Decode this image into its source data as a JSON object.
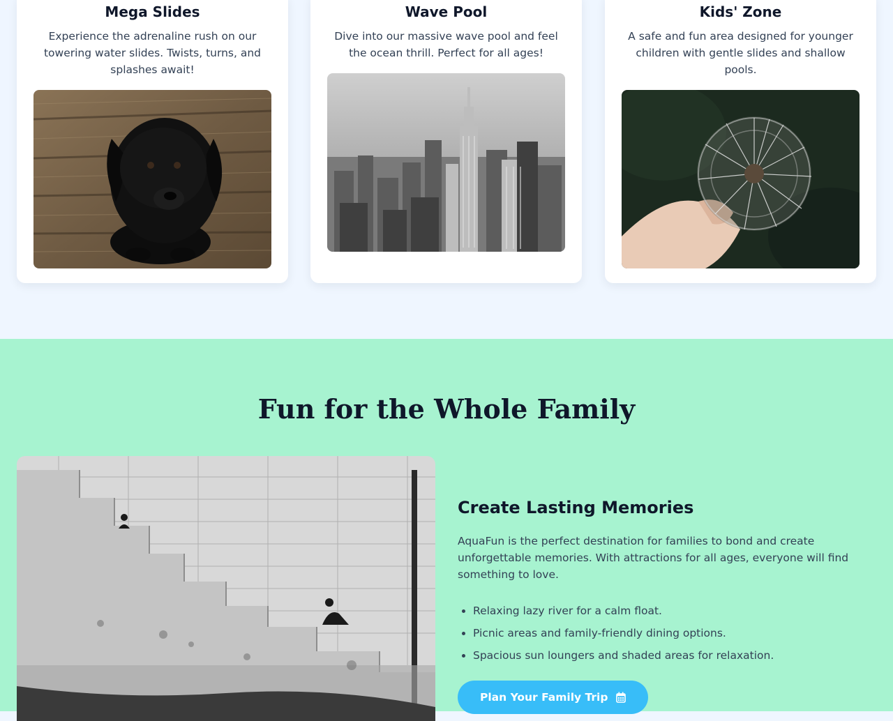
{
  "attractions": [
    {
      "title": "Mega Slides",
      "description": "Experience the adrenaline rush on our towering water slides. Twists, turns, and splashes await!",
      "image_icon": "black-puppy-photo"
    },
    {
      "title": "Wave Pool",
      "description": "Dive into our massive wave pool and feel the ocean thrill. Perfect for all ages!",
      "image_icon": "city-skyline-photo"
    },
    {
      "title": "Kids' Zone",
      "description": "A safe and fun area designed for younger children with gentle slides and shallow pools.",
      "image_icon": "dandelion-photo"
    }
  ],
  "family": {
    "section_title": "Fun for the Whole Family",
    "heading": "Create Lasting Memories",
    "description": "AquaFun is the perfect destination for families to bond and create unforgettable memories. With attractions for all ages, everyone will find something to love.",
    "features": [
      "Relaxing lazy river for a calm float.",
      "Picnic areas and family-friendly dining options.",
      "Spacious sun loungers and shaded areas for relaxation."
    ],
    "cta_label": "Plan Your Family Trip",
    "cta_icon": "calendar-icon",
    "image_icon": "stone-steps-photo"
  },
  "colors": {
    "page_background": "#eff6ff",
    "family_background": "#a7f3d0",
    "accent": "#38bdf8",
    "heading_text": "#0f172a",
    "body_text": "#334155"
  }
}
